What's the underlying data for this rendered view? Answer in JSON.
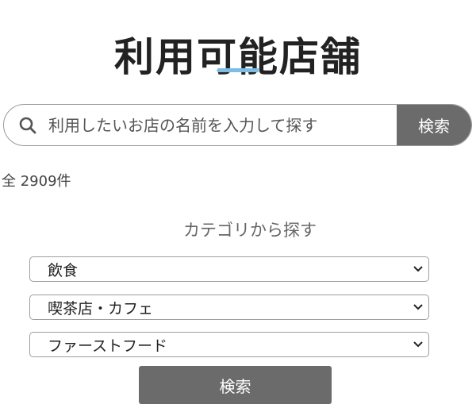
{
  "page": {
    "title": "利用可能店舗",
    "accent_color": "#7dbde3"
  },
  "search": {
    "placeholder": "利用したいお店の名前を入力して探す",
    "value": "",
    "submit_label": "検索",
    "icon": "search-icon"
  },
  "results": {
    "count_label": "全 2909件"
  },
  "category": {
    "heading": "カテゴリから探す",
    "selects": [
      {
        "selected": "飲食"
      },
      {
        "selected": "喫茶店・カフェ"
      },
      {
        "selected": "ファーストフード"
      }
    ],
    "submit_label": "検索"
  },
  "colors": {
    "button_bg": "#6b6b6b",
    "button_text": "#ffffff"
  }
}
